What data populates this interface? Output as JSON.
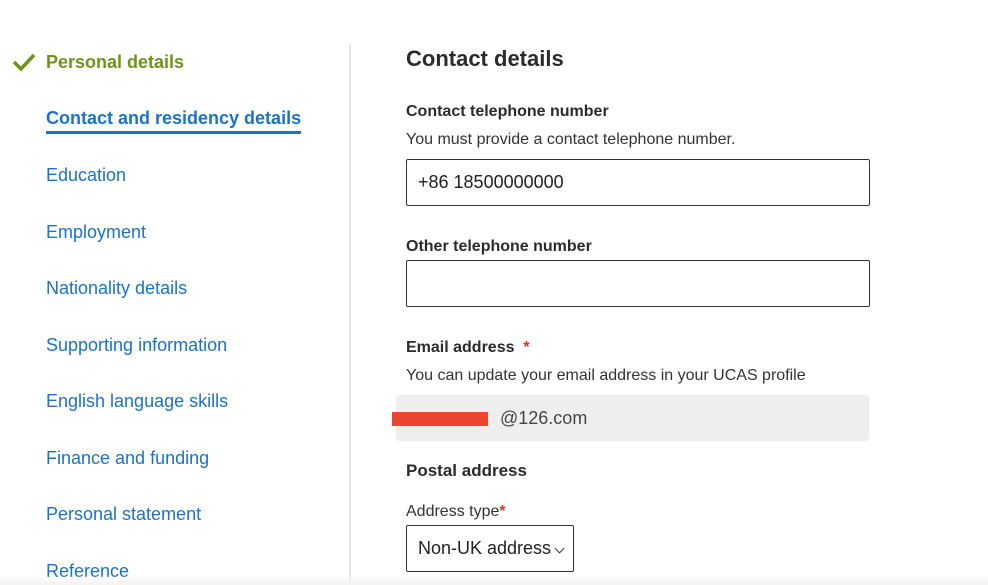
{
  "sidebar": {
    "items": [
      {
        "label": "Personal details",
        "state": "complete"
      },
      {
        "label": "Contact and residency details",
        "state": "current"
      },
      {
        "label": "Education"
      },
      {
        "label": "Employment"
      },
      {
        "label": "Nationality details"
      },
      {
        "label": "Supporting information"
      },
      {
        "label": "English language skills"
      },
      {
        "label": "Finance and funding"
      },
      {
        "label": "Personal statement"
      },
      {
        "label": "Reference"
      }
    ],
    "complete_icon": "check-icon",
    "colors": {
      "complete": "#6f9417",
      "link": "#1a73c8"
    }
  },
  "main": {
    "title": "Contact details",
    "phone": {
      "label": "Contact telephone number",
      "hint": "You must provide a contact telephone number.",
      "value": "+86 18500000000"
    },
    "other_phone": {
      "label": "Other telephone number",
      "value": ""
    },
    "email": {
      "label": "Email address",
      "required_mark": "*",
      "hint": "You can update your email address in your UCAS profile",
      "value_visible": "@126.com"
    },
    "postal": {
      "title": "Postal address",
      "address_type_label": "Address type",
      "required_mark": "*",
      "address_type_value": "Non-UK address"
    }
  }
}
